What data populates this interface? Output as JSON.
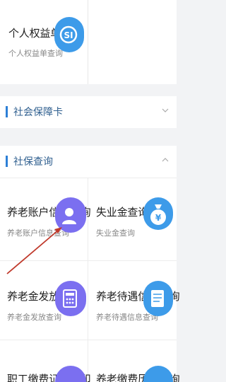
{
  "top_card": {
    "title": "个人权益单查询",
    "subtitle": "个人权益单查询",
    "icon": "si-logo-icon"
  },
  "sections": [
    {
      "label": "社会保障卡",
      "expanded": false
    },
    {
      "label": "社保查询",
      "expanded": true
    }
  ],
  "grid": [
    {
      "title": "养老账户信息查询",
      "subtitle": "养老账户信息查询",
      "icon": "person-icon"
    },
    {
      "title": "失业金查询",
      "subtitle": "失业金查询",
      "icon": "money-bag-icon"
    },
    {
      "title": "养老金发放查询",
      "subtitle": "养老金发放查询",
      "icon": "calculator-icon"
    },
    {
      "title": "养老待遇信息查询",
      "subtitle": "养老待遇信息查询",
      "icon": "document-icon"
    },
    {
      "title": "职工缴费证明打印",
      "subtitle": "",
      "icon": ""
    },
    {
      "title": "养老缴费历史查询",
      "subtitle": "",
      "icon": ""
    }
  ],
  "colors": {
    "accent": "#2d7fd6",
    "icon_blue": "#3d9be9",
    "icon_purple": "#7b6ff0",
    "arrow": "#c0392b"
  }
}
